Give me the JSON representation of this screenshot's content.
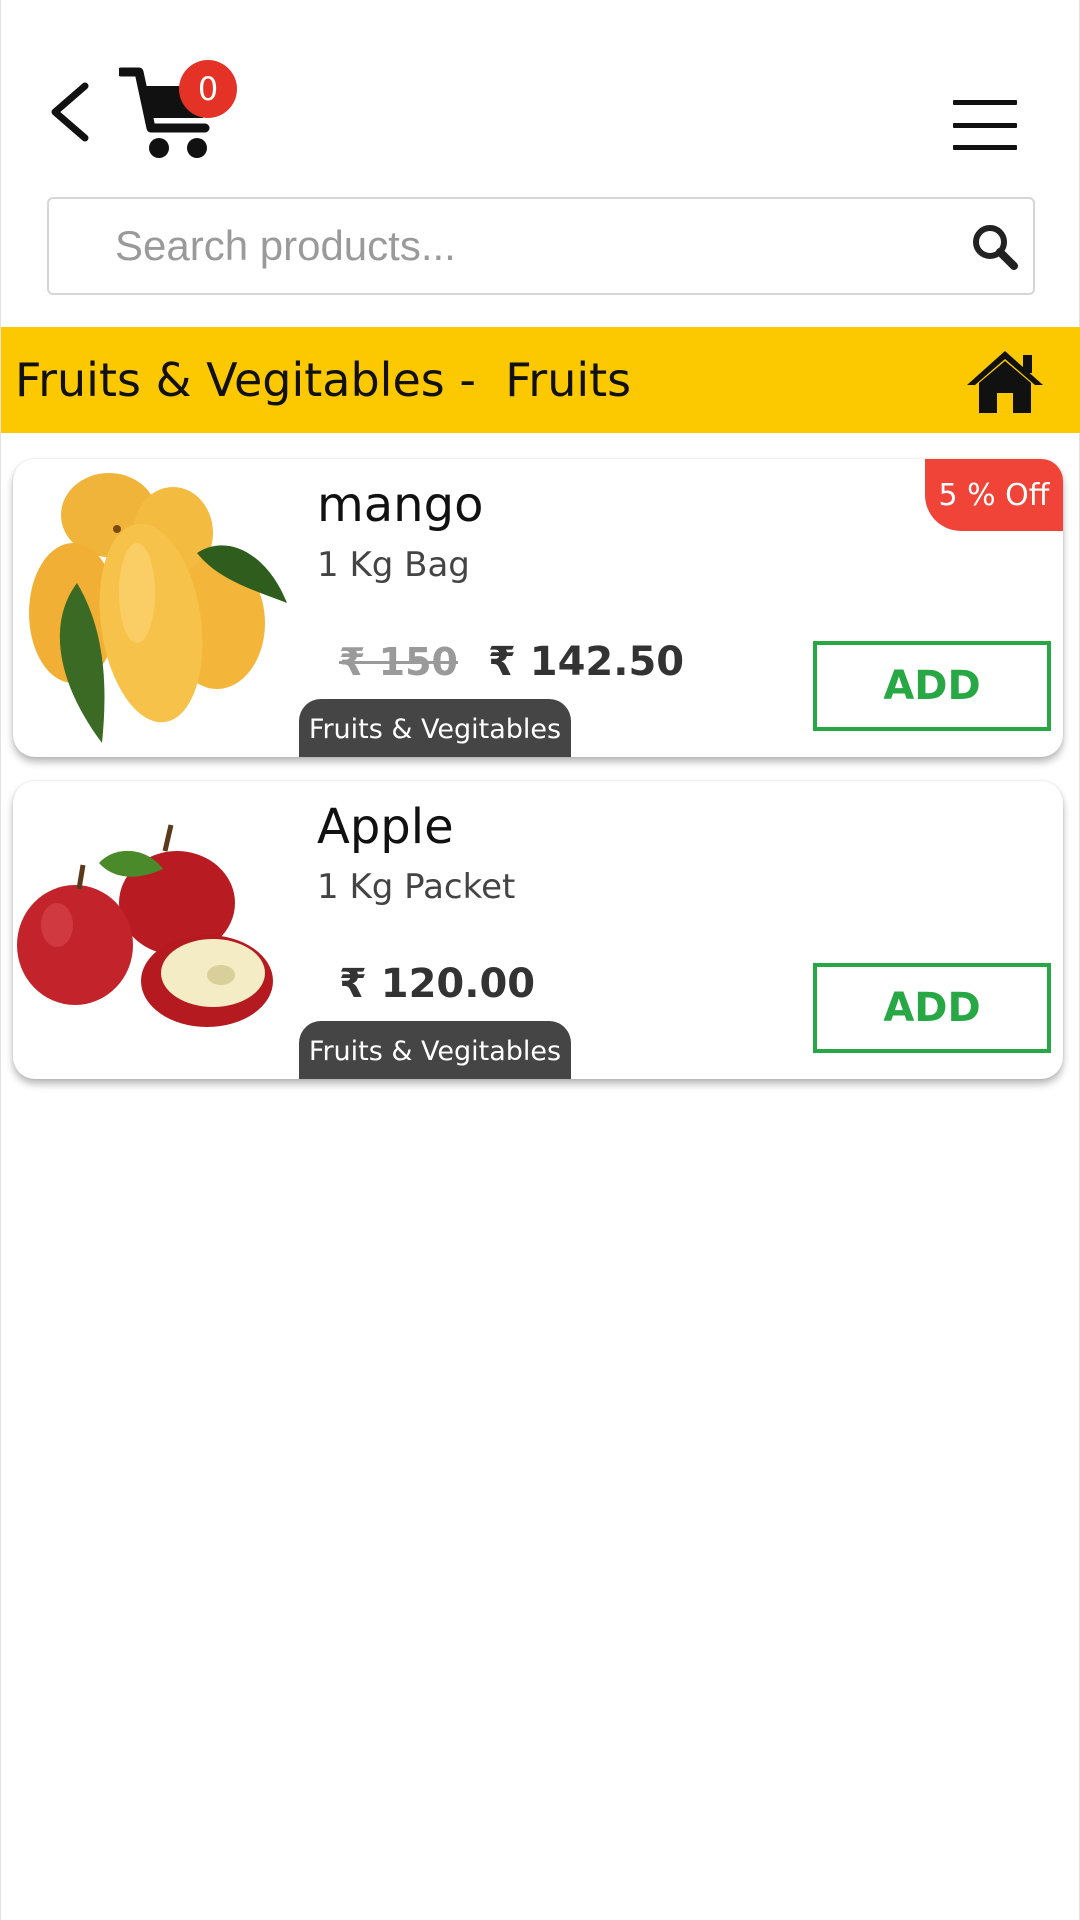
{
  "header": {
    "cart_count": "0"
  },
  "search": {
    "placeholder": "Search products..."
  },
  "category_bar": {
    "title": "Fruits & Vegitables -  Fruits"
  },
  "products": [
    {
      "name": "mango",
      "unit": "1 Kg Bag",
      "old_price": "₹ 150",
      "price": "₹ 142.50",
      "category": "Fruits & Vegitables",
      "discount": "5 % Off",
      "add_label": "ADD",
      "image": "mango-image"
    },
    {
      "name": "Apple",
      "unit": "1 Kg Packet",
      "price": "₹ 120.00",
      "category": "Fruits & Vegitables",
      "add_label": "ADD",
      "image": "apple-image"
    }
  ],
  "colors": {
    "accent_yellow": "#fcc800",
    "badge_red": "#e53226",
    "discount_red": "#f04438",
    "add_green": "#28a745",
    "tag_dark": "#454545"
  },
  "icons": [
    "back-arrow-icon",
    "cart-icon",
    "hamburger-menu-icon",
    "search-icon",
    "home-icon"
  ]
}
